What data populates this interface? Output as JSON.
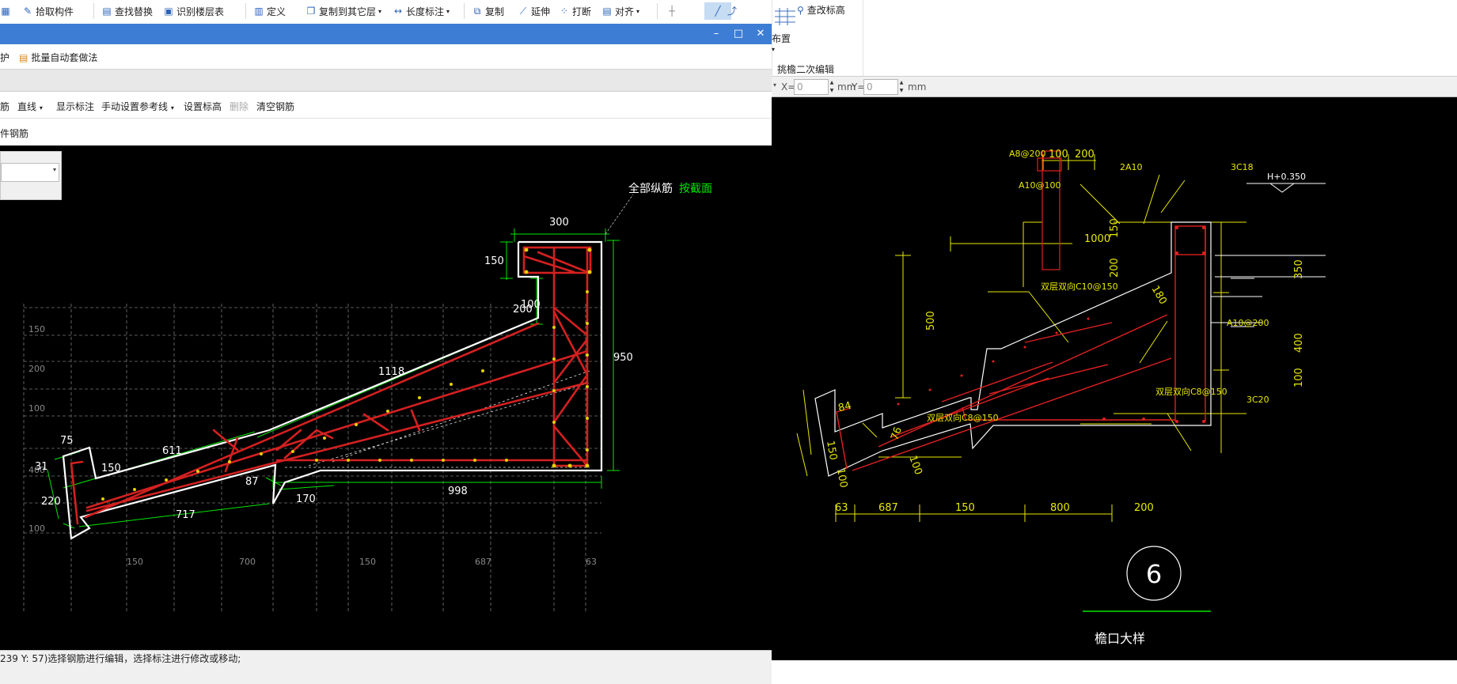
{
  "ribbon": {
    "items": [
      {
        "label": "拾取构件",
        "icon": "pick-icon"
      },
      {
        "label": "查找替换",
        "icon": "find-replace-icon"
      },
      {
        "label": "识别楼层表",
        "icon": "floor-table-icon"
      },
      {
        "label": "定义",
        "icon": "define-icon"
      },
      {
        "label": "复制到其它层",
        "icon": "copy-layer-icon",
        "dropdown": true
      },
      {
        "label": "长度标注",
        "icon": "length-dim-icon",
        "dropdown": true
      },
      {
        "label": "复制",
        "icon": "copy-icon"
      },
      {
        "label": "延伸",
        "icon": "extend-icon"
      },
      {
        "label": "打断",
        "icon": "break-icon"
      },
      {
        "label": "对齐",
        "icon": "align-icon",
        "dropdown": true
      }
    ],
    "right": {
      "place_label": "布置",
      "edit_height_label": "查改标高",
      "group_label": "挑檐二次编辑"
    }
  },
  "dialog": {
    "toolbar1": {
      "protect_label": "护",
      "batch_label": "批量自动套做法"
    },
    "toolbar2": {
      "rebar_label": "筋",
      "line_label": "直线",
      "show_dim_label": "显示标注",
      "ref_line_label": "手动设置参考线",
      "set_elev_label": "设置标高",
      "delete_label": "删除",
      "clear_label": "清空钢筋"
    },
    "toolbar3": {
      "rebar_label": "件钢筋"
    },
    "status": "239 Y: 57)选择钢筋进行编辑，选择标注进行修改或移动;"
  },
  "coord": {
    "x_label": "X=",
    "x_value": "0",
    "x_unit": "mm",
    "y_label": "Y=",
    "y_value": "0",
    "y_unit": "mm"
  },
  "left_drawing": {
    "annotation_text": "全部纵筋",
    "annotation_link": "按截面",
    "dims": [
      "300",
      "150",
      "100",
      "200",
      "950",
      "1118",
      "611",
      "75",
      "31",
      "150",
      "220",
      "87",
      "170",
      "717",
      "998"
    ],
    "grid_labels_left": [
      "150",
      "200",
      "100",
      "400",
      "100"
    ],
    "grid_labels_bottom": [
      "150",
      "700",
      "150",
      "687",
      "63"
    ]
  },
  "right_drawing": {
    "labels": {
      "a8": "A8@200",
      "a10_100": "A10@100",
      "two_a10": "2A10",
      "c18": "3C18",
      "elev": "H+0.350",
      "c10": "双层双向C10@150",
      "a10_200": "A10@200",
      "c8_right": "双层双向C8@150",
      "c8_left": "双层双向C8@150",
      "c20": "3C20",
      "title": "檐口大样",
      "detail_no": "6"
    },
    "dims": [
      "100",
      "200",
      "150",
      "200",
      "1000",
      "350",
      "500",
      "180",
      "400",
      "100",
      "84",
      "76",
      "150",
      "100",
      "100",
      "63",
      "687",
      "150",
      "800",
      "200"
    ]
  },
  "colors": {
    "titlebar": "#3e7dd4",
    "cad_white": "#ffffff",
    "cad_green": "#00e600",
    "cad_red": "#e02020",
    "cad_yellow": "#e8e800",
    "cad_grid": "#777777"
  }
}
